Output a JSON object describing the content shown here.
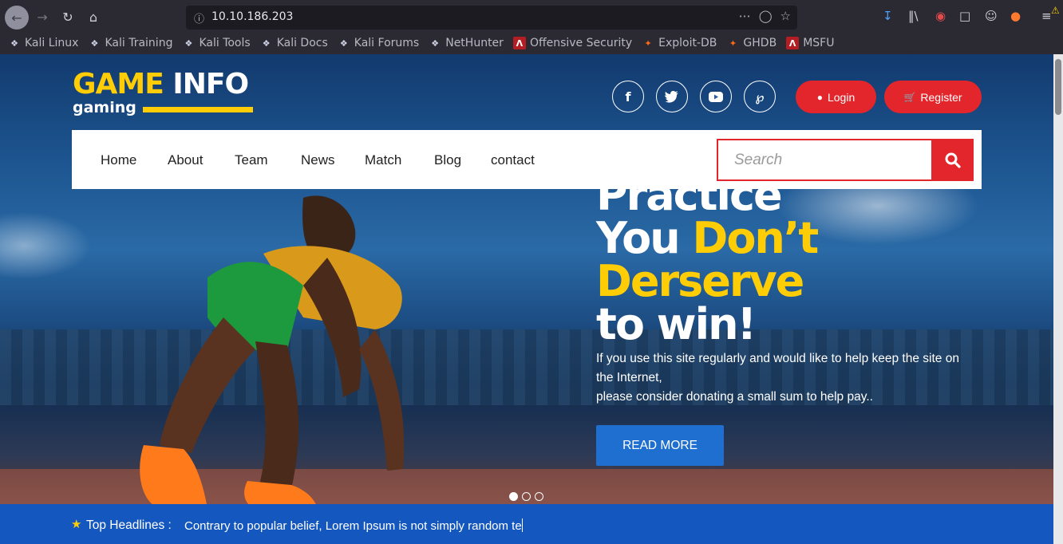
{
  "browser": {
    "url": "10.10.186.203",
    "icons": [
      "back-icon",
      "forward-icon",
      "reload-icon",
      "home-icon",
      "info-icon",
      "more-icon",
      "pocket-icon",
      "star-icon",
      "download-icon",
      "library-icon",
      "ublock-icon",
      "sidebar-icon",
      "account-icon",
      "extension-icon",
      "menu-icon",
      "warning-icon"
    ],
    "bookmarks": [
      {
        "label": "Kali Linux",
        "icon": "kali-icon"
      },
      {
        "label": "Kali Training",
        "icon": "kali-icon"
      },
      {
        "label": "Kali Tools",
        "icon": "kali-icon"
      },
      {
        "label": "Kali Docs",
        "icon": "kali-icon"
      },
      {
        "label": "Kali Forums",
        "icon": "kali-icon"
      },
      {
        "label": "NetHunter",
        "icon": "kali-icon"
      },
      {
        "label": "Offensive Security",
        "icon": "offsec-icon"
      },
      {
        "label": "Exploit-DB",
        "icon": "exploitdb-icon"
      },
      {
        "label": "GHDB",
        "icon": "exploitdb-icon"
      },
      {
        "label": "MSFU",
        "icon": "offsec-icon"
      }
    ]
  },
  "site": {
    "logo": {
      "word1": "GAME",
      "word2": "INFO",
      "sub": "gaming"
    },
    "social": [
      "facebook-icon",
      "twitter-icon",
      "youtube-icon",
      "pinterest-icon"
    ],
    "login_label": "Login",
    "register_label": "Register",
    "nav": [
      "Home",
      "About",
      "Team",
      "News",
      "Match",
      "Blog",
      "contact"
    ],
    "search_placeholder": "Search",
    "hero": {
      "line1": "Practice",
      "line2a": "You ",
      "line2b": "Don’t",
      "line3": "Derserve",
      "line4": "to win!",
      "desc1": "If you use this site regularly and would like to help keep the site on the Internet,",
      "desc2": "please consider donating a small sum to help pay..",
      "cta": "READ MORE"
    },
    "headline": {
      "label": "Top Headlines :",
      "text": "Contrary to popular belief, Lorem Ipsum is not simply random te"
    }
  },
  "colors": {
    "brand_yellow": "#ffcd05",
    "accent_red": "#e3262b",
    "accent_blue": "#1e6fd0",
    "headline_bar": "#1457bf"
  }
}
